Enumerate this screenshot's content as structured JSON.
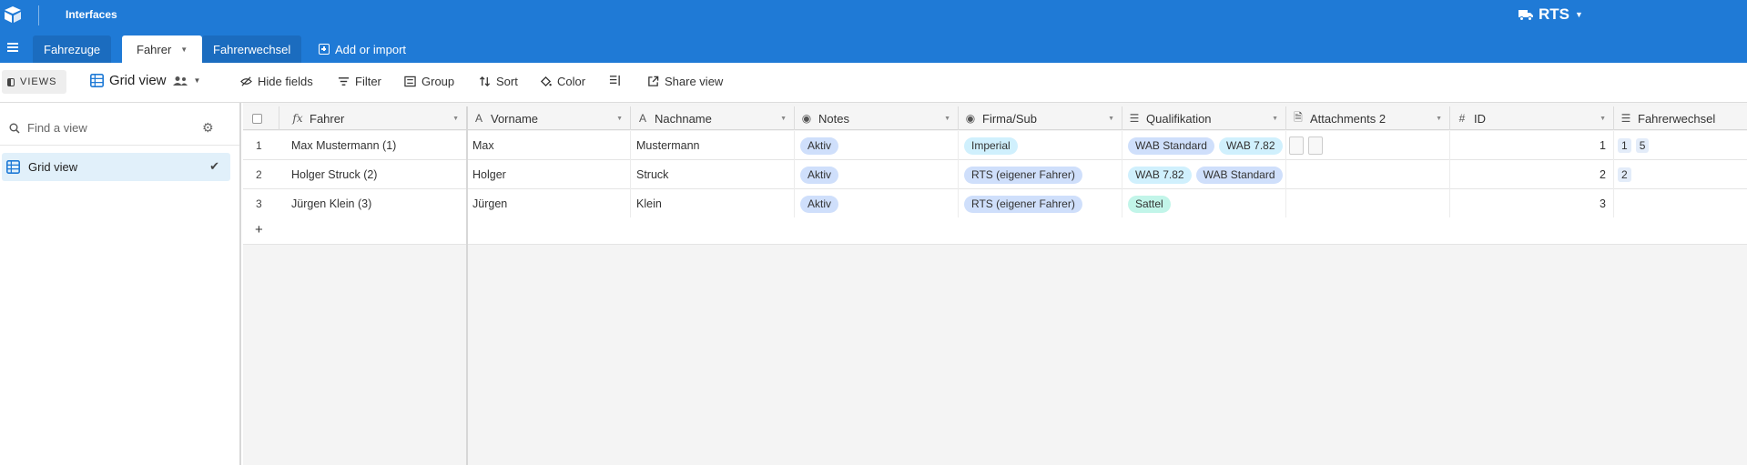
{
  "topbar": {
    "app_title": "Interfaces",
    "base_name": "RTS",
    "bg": "#1f7ad6"
  },
  "tabs": [
    {
      "label": "Fahrezuge",
      "active": false
    },
    {
      "label": "Fahrer",
      "active": true
    },
    {
      "label": "Fahrerwechsel",
      "active": false
    }
  ],
  "add_tab_label": "Add or import",
  "toolbar": {
    "views_label": "VIEWS",
    "view_name": "Grid view",
    "hide_fields": "Hide fields",
    "filter": "Filter",
    "group": "Group",
    "sort": "Sort",
    "color": "Color",
    "share": "Share view"
  },
  "sidebar": {
    "find_placeholder": "Find a view",
    "views": [
      {
        "label": "Grid view",
        "selected": true
      }
    ]
  },
  "columns": [
    {
      "name": "Fahrer",
      "icon": "formula-icon"
    },
    {
      "name": "Vorname",
      "icon": "text-icon"
    },
    {
      "name": "Nachname",
      "icon": "text-icon"
    },
    {
      "name": "Notes",
      "icon": "single-select-icon"
    },
    {
      "name": "Firma/Sub",
      "icon": "single-select-icon"
    },
    {
      "name": "Qualifikation",
      "icon": "multi-select-icon"
    },
    {
      "name": "Attachments 2",
      "icon": "attachment-icon"
    },
    {
      "name": "ID",
      "icon": "number-icon"
    },
    {
      "name": "Fahrerwechsel",
      "icon": "link-icon"
    }
  ],
  "rows": [
    {
      "num": "1",
      "fahrer": "Max Mustermann (1)",
      "vorname": "Max",
      "nachname": "Mustermann",
      "notes": "Aktiv",
      "firma": "Imperial",
      "qual": [
        "WAB Standard",
        "WAB 7.82"
      ],
      "attachments": 2,
      "id": "1",
      "wechsel": [
        "1",
        "5"
      ]
    },
    {
      "num": "2",
      "fahrer": "Holger Struck (2)",
      "vorname": "Holger",
      "nachname": "Struck",
      "notes": "Aktiv",
      "firma": "RTS (eigener Fahrer)",
      "qual": [
        "WAB 7.82",
        "WAB Standard"
      ],
      "attachments": 0,
      "id": "2",
      "wechsel": [
        "2"
      ]
    },
    {
      "num": "3",
      "fahrer": "Jürgen Klein (3)",
      "vorname": "Jürgen",
      "nachname": "Klein",
      "notes": "Aktiv",
      "firma": "RTS (eigener Fahrer)",
      "qual": [
        "Sattel"
      ],
      "attachments": 0,
      "id": "3",
      "wechsel": []
    }
  ],
  "add_row_label": "+"
}
